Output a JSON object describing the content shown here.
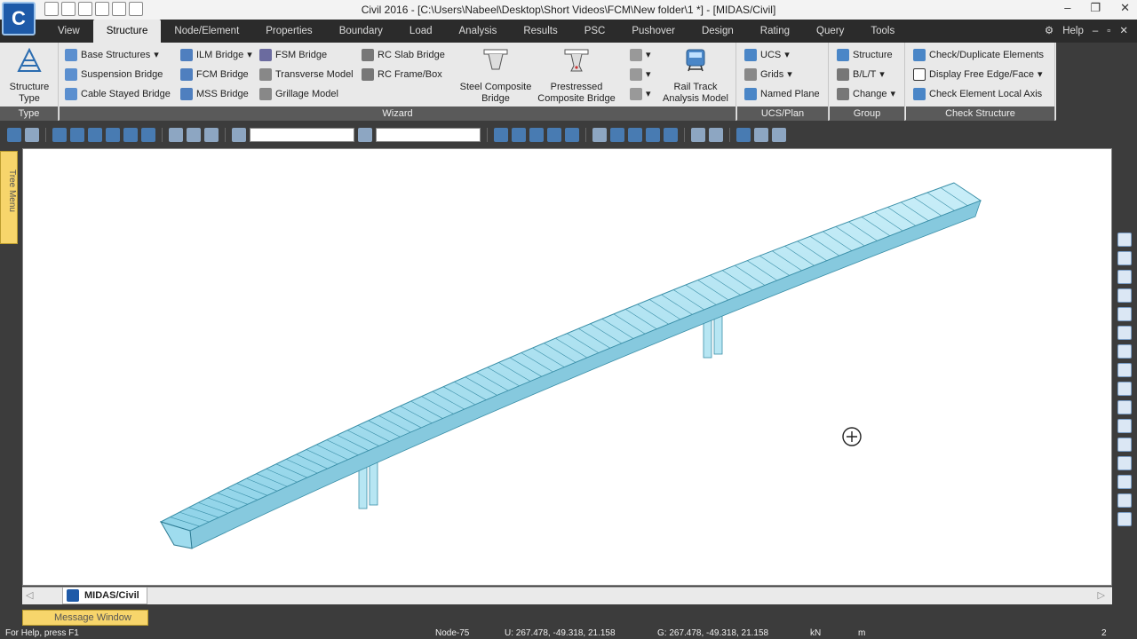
{
  "window": {
    "title": "Civil 2016 - [C:\\Users\\Nabeel\\Desktop\\Short Videos\\FCM\\New folder\\1 *] - [MIDAS/Civil]",
    "logo_text": "C"
  },
  "tabs": [
    "View",
    "Structure",
    "Node/Element",
    "Properties",
    "Boundary",
    "Load",
    "Analysis",
    "Results",
    "PSC",
    "Pushover",
    "Design",
    "Rating",
    "Query",
    "Tools"
  ],
  "help_label": "Help",
  "ribbon": {
    "type_group": {
      "label": "Type",
      "button": "Structure Type"
    },
    "wizard_group": {
      "label": "Wizard",
      "col1": [
        "Base Structures",
        "Suspension Bridge",
        "Cable Stayed Bridge"
      ],
      "col2": [
        "ILM Bridge",
        "FCM Bridge",
        "MSS Bridge"
      ],
      "col3": [
        "FSM Bridge",
        "Transverse Model",
        "Grillage Model"
      ],
      "col4": [
        "RC Slab Bridge",
        "RC Frame/Box"
      ],
      "big1_line1": "Steel Composite",
      "big1_line2": "Bridge",
      "big2_line1": "Prestressed",
      "big2_line2": "Composite Bridge",
      "big3_line1": "Rail Track",
      "big3_line2": "Analysis Model"
    },
    "ucs_group": {
      "label": "UCS/Plan",
      "items": [
        "UCS",
        "Grids",
        "Named Plane"
      ]
    },
    "group_group": {
      "label": "Group",
      "items": [
        "Structure",
        "B/L/T",
        "Change"
      ]
    },
    "check_group": {
      "label": "Check Structure",
      "items": [
        "Check/Duplicate Elements",
        "Display Free Edge/Face",
        "Check Element Local Axis"
      ]
    }
  },
  "side_tab": "Tree Menu",
  "doc_tab": "MIDAS/Civil",
  "message_window": "Message Window",
  "status": {
    "help": "For Help, press F1",
    "node": "Node-75",
    "u_coords": "U: 267.478, -49.318, 21.158",
    "g_coords": "G: 267.478, -49.318, 21.158",
    "force_unit": "kN",
    "length_unit": "m",
    "zoom": "2"
  },
  "colors": {
    "deck_fill": "#a9e3f2",
    "deck_edge": "#3a8fa8",
    "deck_top": "#c9eef8"
  }
}
